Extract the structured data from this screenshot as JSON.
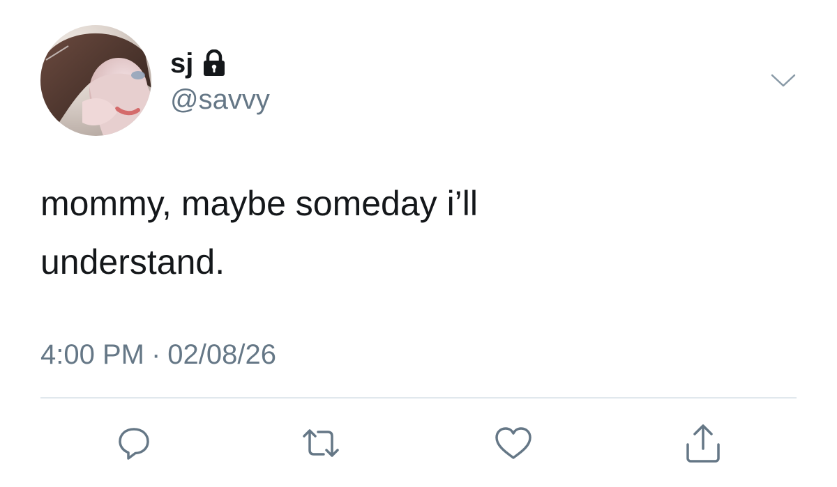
{
  "tweet": {
    "display_name": "sj",
    "handle": "@savvy",
    "protected_icon": "lock-icon",
    "menu_icon": "chevron-down-icon",
    "text": "mommy, maybe someday i’ll\nunderstand.",
    "time": "4:00 PM",
    "separator": "·",
    "date": "02/08/26"
  },
  "actions": [
    {
      "icon": "reply-icon"
    },
    {
      "icon": "retweet-icon"
    },
    {
      "icon": "like-icon"
    },
    {
      "icon": "share-icon"
    }
  ],
  "colors": {
    "text": "#14171a",
    "secondary": "#657786",
    "divider": "#e1e8ed",
    "background": "#ffffff"
  }
}
